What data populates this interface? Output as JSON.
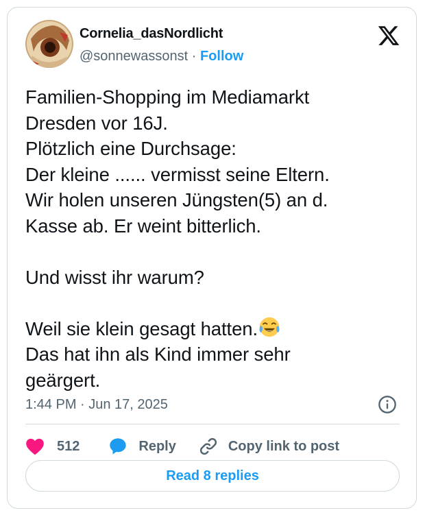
{
  "author": {
    "display_name": "Cornelia_dasNordlicht",
    "handle": "@sonnewassonst",
    "separator": "·",
    "follow_label": "Follow",
    "avatar_icon": "avatar-photo"
  },
  "tweet": {
    "text": "Familien-Shopping im Mediamarkt\nDresden vor 16J.\nPlötzlich eine Durchsage:\nDer kleine ...... vermisst seine Eltern.\nWir holen unseren Jüngsten(5) an d.\nKasse ab. Er weint bitterlich.\n\nUnd wisst ihr warum?\n\nWeil sie klein gesagt hatten.",
    "text_after_emoji": "\nDas hat ihn als Kind immer sehr\ngeärgert.",
    "emoji": "face-with-tears-of-joy",
    "timestamp": "1:44 PM · Jun 17, 2025"
  },
  "actions": {
    "like_count": "512",
    "reply_label": "Reply",
    "copy_link_label": "Copy link to post"
  },
  "read_replies_label": "Read 8 replies",
  "colors": {
    "accent": "#1d9bf0",
    "like": "#f91880",
    "muted": "#536471",
    "border": "#cfd9de"
  }
}
